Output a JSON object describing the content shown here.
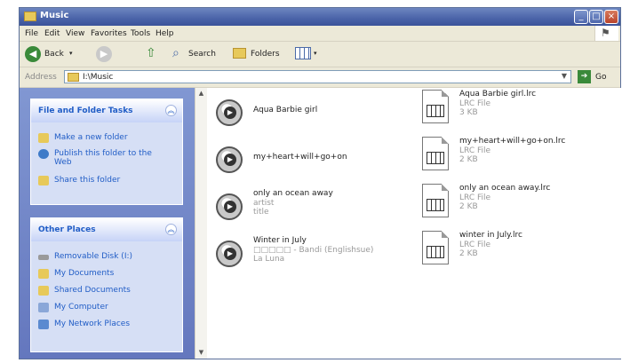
{
  "window": {
    "title": "Music"
  },
  "menu": [
    "File",
    "Edit",
    "View",
    "Favorites",
    "Tools",
    "Help"
  ],
  "toolbar": {
    "back": "Back",
    "search": "Search",
    "folders": "Folders"
  },
  "address": {
    "label": "Address",
    "value": "I:\\Music",
    "go": "Go"
  },
  "tasks_panel": {
    "title": "File and Folder Tasks",
    "items": [
      "Make a new folder",
      "Publish this folder to the Web",
      "Share this folder"
    ]
  },
  "places_panel": {
    "title": "Other Places",
    "items": [
      "Removable Disk (I:)",
      "My Documents",
      "Shared Documents",
      "My Computer",
      "My Network Places"
    ]
  },
  "files": [
    {
      "name": "Aqua Barbie girl",
      "line2": "",
      "line3": "",
      "icon": "media-file-icon"
    },
    {
      "name": "Aqua Barbie girl.lrc",
      "line2": "LRC File",
      "line3": "3 KB",
      "icon": "lrc-file-icon"
    },
    {
      "name": "my+heart+will+go+on",
      "line2": "",
      "line3": "",
      "icon": "media-file-icon"
    },
    {
      "name": "my+heart+will+go+on.lrc",
      "line2": "LRC File",
      "line3": "2 KB",
      "icon": "lrc-file-icon"
    },
    {
      "name": "only an ocean away",
      "line2": "artist",
      "line3": "title",
      "icon": "media-file-icon"
    },
    {
      "name": "only an ocean away.lrc",
      "line2": "LRC File",
      "line3": "2 KB",
      "icon": "lrc-file-icon"
    },
    {
      "name": "Winter in July",
      "line2": "□□□□□ - Bandi (Englishsue)",
      "line3": "La Luna",
      "icon": "media-file-icon"
    },
    {
      "name": "winter in July.lrc",
      "line2": "LRC File",
      "line3": "2 KB",
      "icon": "lrc-file-icon"
    }
  ]
}
